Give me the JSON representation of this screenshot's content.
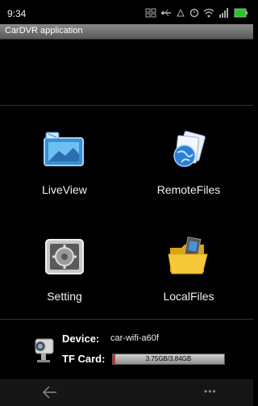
{
  "status_bar": {
    "time": "9:34",
    "icons": [
      "screen-mirror-icon",
      "usb-icon",
      "usb-debug-icon",
      "alarm-icon",
      "wifi-icon",
      "signal-icon",
      "battery-icon"
    ]
  },
  "app": {
    "title": "CarDVR application"
  },
  "tiles": [
    {
      "label": "LiveView",
      "icon": "liveview-icon"
    },
    {
      "label": "RemoteFiles",
      "icon": "remote-files-icon"
    },
    {
      "label": "Setting",
      "icon": "setting-icon"
    },
    {
      "label": "LocalFiles",
      "icon": "local-files-icon"
    }
  ],
  "device": {
    "device_label": "Device:",
    "device_name": "car-wifi-a60f",
    "tf_label": "TF Card:",
    "storage_text": "3.75GB/3.84GB",
    "storage_used_fraction": 0.02
  },
  "navbar": {
    "more": "•••"
  },
  "colors": {
    "title_bar": "#6e6e6e",
    "storage_fill": "#cc3333",
    "battery": "#22cc22"
  }
}
